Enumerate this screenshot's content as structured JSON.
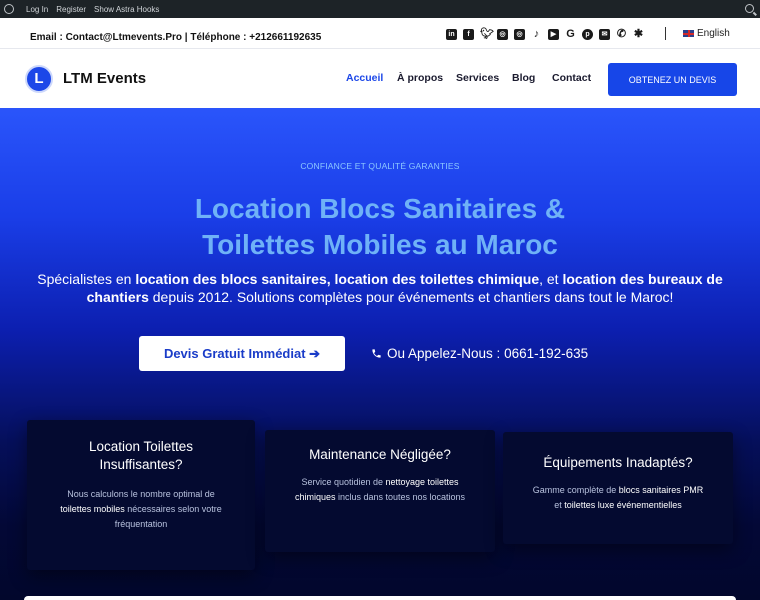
{
  "adminbar": {
    "items": [
      "Log In",
      "Register",
      "Show Astra Hooks"
    ]
  },
  "topbar": {
    "contact": "Email : Contact@Ltmevents.Pro | Téléphone : +212661192635",
    "socials": [
      "linkedin-icon",
      "facebook-icon",
      "twitter-icon",
      "instagram-icon",
      "instagram-icon",
      "tiktok-icon",
      "youtube-icon",
      "google-icon",
      "pinterest-icon",
      "email-icon",
      "phone-icon",
      "yelp-icon"
    ],
    "language": "English"
  },
  "header": {
    "logo_letter": "L",
    "brand": "LTM Events",
    "nav": [
      "Accueil",
      "À propos",
      "Services",
      "Blog",
      "Contact"
    ],
    "cta": "OBTENEZ UN DEVIS"
  },
  "hero": {
    "eyebrow": "CONFIANCE ET QUALITÉ GARANTIES",
    "title_line1": "Location Blocs Sanitaires &",
    "title_line2": "Toilettes Mobiles au Maroc",
    "lead": {
      "p1": "Spécialistes en ",
      "b1": "location des blocs sanitaires, location des toilettes chimique",
      "p2": ", et ",
      "b2": "location des bureaux de chantiers",
      "p3": " depuis 2012. Solutions complètes pour événements et chantiers dans tout le Maroc!"
    },
    "primary_button": "Devis Gratuit Immédiat ➔",
    "call_text": "Ou Appelez-Nous : 0661-192-635"
  },
  "cards": [
    {
      "title": "Location Toilettes Insuffisantes?",
      "d1": "Nous calculons le nombre optimal de ",
      "b1": "toilettes mobiles",
      "d2": " nécessaires selon votre fréquentation"
    },
    {
      "title": "Maintenance Négligée?",
      "d1": "Service quotidien de ",
      "b1": "nettoyage toilettes chimiques",
      "d2": " inclus dans toutes nos locations"
    },
    {
      "title": "Équipements Inadaptés?",
      "d1": "Gamme complète de ",
      "b1": "blocs sanitaires PMR",
      "d2": " et ",
      "b2": "toilettes luxe événementielles"
    }
  ]
}
